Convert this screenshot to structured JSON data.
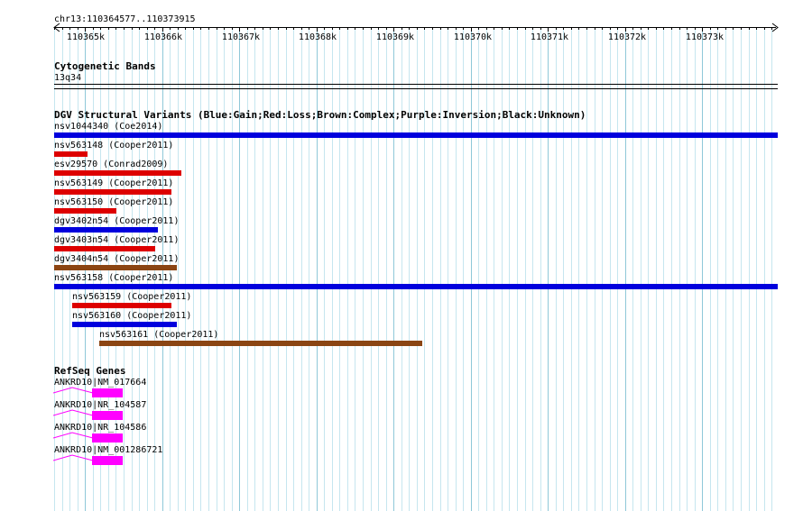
{
  "locus": "chr13:110364577..110373915",
  "ruler": {
    "ticks": [
      "110365k",
      "110366k",
      "110367k",
      "110368k",
      "110369k",
      "110370k",
      "110371k",
      "110372k",
      "110373k"
    ]
  },
  "cytogenetic": {
    "title": "Cytogenetic Bands",
    "band": "13q34"
  },
  "dgv": {
    "title": "DGV Structural Variants (Blue:Gain;Red:Loss;Brown:Complex;Purple:Inversion;Black:Unknown)",
    "variants": [
      {
        "label": "nsv1044340 (Coe2014)",
        "color": "#0000dd"
      },
      {
        "label": "nsv563148 (Cooper2011)",
        "color": "#dd0000"
      },
      {
        "label": "esv29570 (Conrad2009)",
        "color": "#dd0000"
      },
      {
        "label": "nsv563149 (Cooper2011)",
        "color": "#dd0000"
      },
      {
        "label": "nsv563150 (Cooper2011)",
        "color": "#dd0000"
      },
      {
        "label": "dgv3402n54 (Cooper2011)",
        "color": "#0000dd"
      },
      {
        "label": "dgv3403n54 (Cooper2011)",
        "color": "#dd0000"
      },
      {
        "label": "dgv3404n54 (Cooper2011)",
        "color": "#8b4513"
      },
      {
        "label": "nsv563158 (Cooper2011)",
        "color": "#0000dd"
      },
      {
        "label": "nsv563159 (Cooper2011)",
        "color": "#dd0000"
      },
      {
        "label": "nsv563160 (Cooper2011)",
        "color": "#0000dd"
      },
      {
        "label": "nsv563161 (Cooper2011)",
        "color": "#8b4513"
      }
    ]
  },
  "refseq": {
    "title": "RefSeq Genes",
    "exon_color": "#ff00ff",
    "genes": [
      {
        "label": "ANKRD10|NM_017664"
      },
      {
        "label": "ANKRD10|NR_104587"
      },
      {
        "label": "ANKRD10|NR_104586"
      },
      {
        "label": "ANKRD10|NM_001286721"
      }
    ]
  }
}
